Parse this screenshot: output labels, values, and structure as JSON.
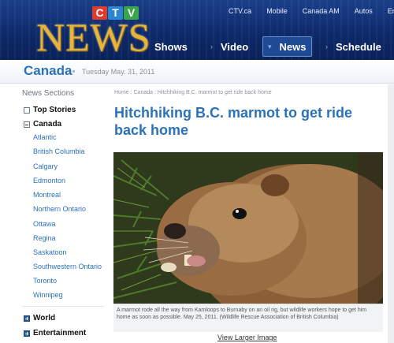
{
  "header": {
    "top_links": [
      "CTV.ca",
      "Mobile",
      "Canada AM",
      "Autos",
      "Ente"
    ],
    "logo": {
      "letters": [
        {
          "char": "C",
          "color": "#e03c2e"
        },
        {
          "char": "T",
          "color": "#2a86d3"
        },
        {
          "char": "V",
          "color": "#3ba54a"
        }
      ],
      "wordmark": "NEWS"
    },
    "nav": [
      {
        "label": "Shows",
        "active": false
      },
      {
        "label": "Video",
        "active": false
      },
      {
        "label": "News",
        "active": true
      },
      {
        "label": "Schedule",
        "active": false
      }
    ]
  },
  "section": {
    "title": "Canada",
    "date": "Tuesday May. 31, 2011"
  },
  "sidebar": {
    "heading": "News Sections",
    "top_stories": "Top Stories",
    "canada": "Canada",
    "canada_items": [
      "Atlantic",
      "British Columbia",
      "Calgary",
      "Edmonton",
      "Montreal",
      "Northern Ontario",
      "Ottawa",
      "Regina",
      "Saskatoon",
      "Southwestern Ontario",
      "Toronto",
      "Winnipeg"
    ],
    "world": "World",
    "entertainment": "Entertainment"
  },
  "article": {
    "breadcrumb": "Home : Canada : Hitchhiking B.C. marmot to get ride back home",
    "headline": "Hitchhiking B.C. marmot to get ride back home",
    "photo_caption": "A marmot rode all the way from Kamloops to Burnaby on an oil rig, but wildlife workers hope to get him home as soon as possible. May 25, 2011. (Wildlife Rescue Association of British Columbia)",
    "larger_image_link": "View Larger Image"
  },
  "colors": {
    "header_blue": "#0e2a6a",
    "link_blue": "#2b72b9",
    "logo_gold": "#e5b53d"
  }
}
